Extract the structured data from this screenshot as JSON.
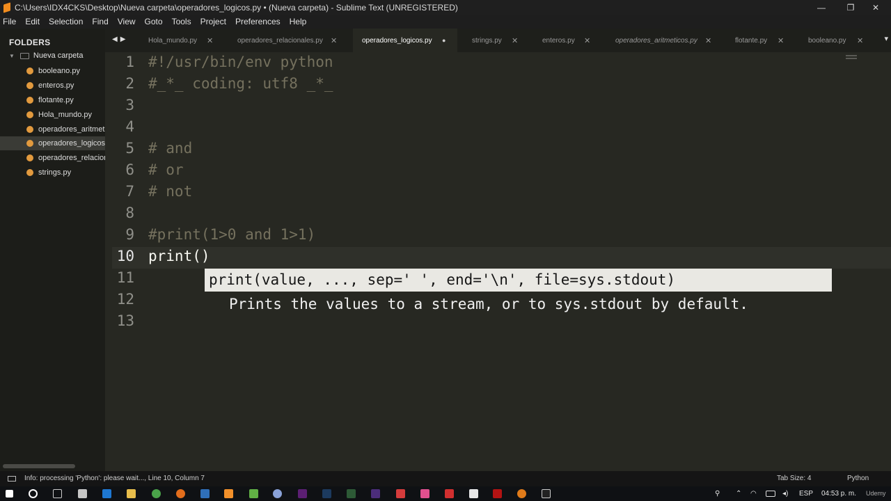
{
  "window": {
    "title": "C:\\Users\\IDX4CKS\\Desktop\\Nueva carpeta\\operadores_logicos.py • (Nueva carpeta) - Sublime Text (UNREGISTERED)",
    "controls": [
      "—",
      "❐",
      "✕"
    ]
  },
  "menu": [
    "File",
    "Edit",
    "Selection",
    "Find",
    "View",
    "Goto",
    "Tools",
    "Project",
    "Preferences",
    "Help"
  ],
  "sidebar": {
    "title": "FOLDERS",
    "folder": "Nueva carpeta",
    "files": [
      "booleano.py",
      "enteros.py",
      "flotante.py",
      "Hola_mundo.py",
      "operadores_aritmeticos.py",
      "operadores_logicos.py",
      "operadores_relacionales.py",
      "strings.py"
    ],
    "active_index": 5
  },
  "tabs": [
    {
      "label": "Hola_mundo.py",
      "close": "✕"
    },
    {
      "label": "operadores_relacionales.py",
      "close": "✕"
    },
    {
      "label": "operadores_logicos.py",
      "close": "●"
    },
    {
      "label": "strings.py",
      "close": "✕"
    },
    {
      "label": "enteros.py",
      "close": "✕"
    },
    {
      "label": "operadores_aritmeticos.py",
      "close": "✕"
    },
    {
      "label": "flotante.py",
      "close": "✕"
    },
    {
      "label": "booleano.py",
      "close": "✕"
    }
  ],
  "active_tab": 2,
  "editor": {
    "line_numbers": [
      "1",
      "2",
      "3",
      "4",
      "5",
      "6",
      "7",
      "8",
      "9",
      "10",
      "11",
      "12",
      "13"
    ],
    "current_line": 10,
    "lines": [
      {
        "text": "#!/usr/bin/env python",
        "kind": "comment"
      },
      {
        "text": "#_*_ coding: utf8 _*_",
        "kind": "comment"
      },
      {
        "text": "",
        "kind": "code"
      },
      {
        "text": "",
        "kind": "code"
      },
      {
        "text": "# and",
        "kind": "comment"
      },
      {
        "text": "# or",
        "kind": "comment"
      },
      {
        "text": "# not",
        "kind": "comment"
      },
      {
        "text": "",
        "kind": "code"
      },
      {
        "text": "#print(1>0 and 1>1)",
        "kind": "comment"
      },
      {
        "text": "print()",
        "kind": "code"
      },
      {
        "text": "",
        "kind": "code"
      },
      {
        "text": "",
        "kind": "code"
      },
      {
        "text": "",
        "kind": "code"
      }
    ]
  },
  "tooltip": {
    "signature": "print(value, ..., sep=' ', end='\\n', file=sys.stdout)",
    "description": "Prints the values to a stream, or to sys.stdout by default."
  },
  "status": {
    "message": "Info: processing 'Python': please wait..., Line 10, Column 7",
    "tab_size": "Tab Size: 4",
    "syntax": "Python"
  },
  "taskbar": {
    "language": "ESP",
    "clock": "04:53 p. m.",
    "watermark": "Udemy"
  }
}
